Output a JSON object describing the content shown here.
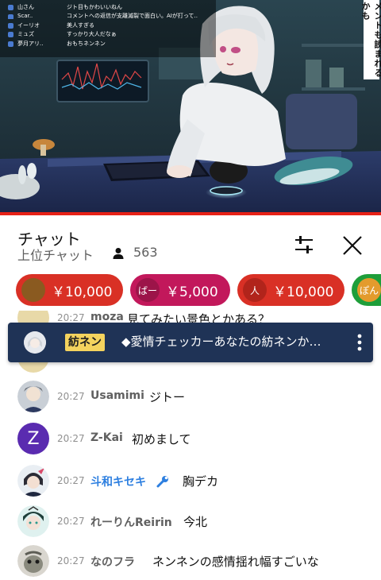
{
  "overlay_chat": [
    {
      "name": "山さん",
      "message": "ジト目もかわいいねん"
    },
    {
      "name": "Scar..",
      "message": "コメントへの返信が支離滅裂で面白い。AIが打って.."
    },
    {
      "name": "イーリオ",
      "message": "美人すぎる"
    },
    {
      "name": "ミュズ",
      "message": "すっかり大人だなぁ"
    },
    {
      "name": "夢月アリ..",
      "message": "おもちネンネン"
    }
  ],
  "overlay_vertical_text": "メントも読まれるかも",
  "chat_header": {
    "title": "チャット",
    "mode": "上位チャット",
    "viewer_count": "563"
  },
  "super_chats": [
    {
      "avatar_text": "",
      "amount": "￥10,000",
      "color": "#d93025"
    },
    {
      "avatar_text": "ばー",
      "amount": "￥5,000",
      "color": "#c2185b"
    },
    {
      "avatar_text": "人",
      "amount": "￥10,000",
      "color": "#d93025"
    },
    {
      "avatar_text": "ぽん",
      "amount": "",
      "color": "#1e9e3a"
    }
  ],
  "pinned": {
    "badge": "紡ネン",
    "text": "◆愛情チェッカーあなたの紡ネンか…"
  },
  "partial_message": {
    "time": "20:27",
    "author": "moza",
    "text": "見てみたい景色とかある？"
  },
  "messages": [
    {
      "time": "20:27",
      "author": "Usamimi",
      "text": "ジトー"
    },
    {
      "time": "20:27",
      "author": "Z-Kai",
      "text": "初めまして",
      "avatar_letter": "Z"
    },
    {
      "time": "20:27",
      "author": "斗和キセキ",
      "text": "胸デカ"
    },
    {
      "time": "20:27",
      "author": "れーりんReirin",
      "text": "今北"
    },
    {
      "time": "20:27",
      "author": "なのフラ",
      "text": "ネンネンの感情揺れ幅すごいな"
    }
  ],
  "colors": {
    "accent_red": "#e62117",
    "pinned_bg": "#1f3356",
    "moderator_blue": "#2d7fe0"
  }
}
